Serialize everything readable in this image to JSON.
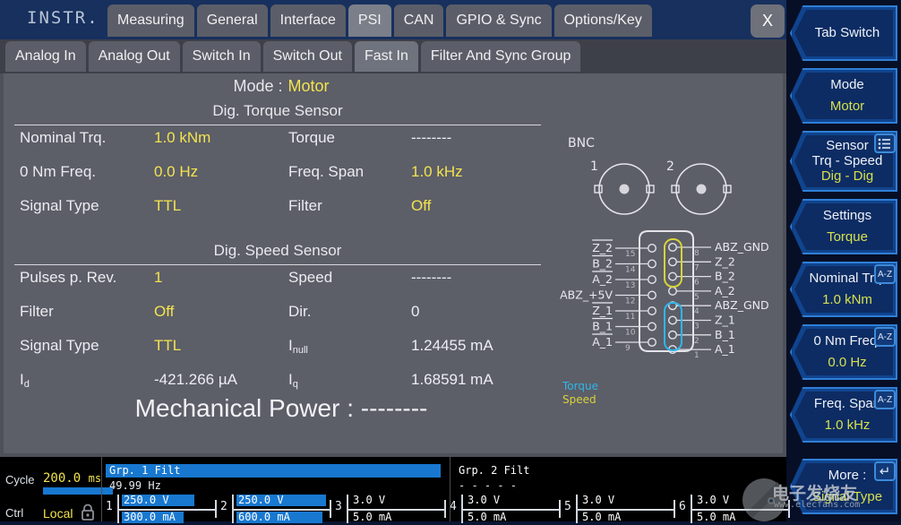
{
  "window": {
    "instrument_label": "INSTR.",
    "close_label": "X"
  },
  "top_tabs": [
    {
      "label": "Measuring",
      "selected": false
    },
    {
      "label": "General",
      "selected": false
    },
    {
      "label": "Interface",
      "selected": false
    },
    {
      "label": "PSI",
      "selected": true
    },
    {
      "label": "CAN",
      "selected": false
    },
    {
      "label": "GPIO & Sync",
      "selected": false
    },
    {
      "label": "Options/Key",
      "selected": false
    }
  ],
  "sub_tabs": [
    {
      "label": "Analog In",
      "selected": false
    },
    {
      "label": "Analog Out",
      "selected": false
    },
    {
      "label": "Switch In",
      "selected": false
    },
    {
      "label": "Switch Out",
      "selected": false
    },
    {
      "label": "Fast In",
      "selected": true
    },
    {
      "label": "Filter And Sync Group",
      "selected": false
    }
  ],
  "main": {
    "mode_label": "Mode :",
    "mode_value": "Motor",
    "torque_section_title": "Dig. Torque Sensor",
    "torque_rows": [
      {
        "label": "Nominal Trq.",
        "value": "1.0 kNm",
        "value_class": "y",
        "label2": "Torque",
        "value2": "--------",
        "value2_class": "w"
      },
      {
        "label": "0 Nm Freq.",
        "value": "0.0 Hz",
        "value_class": "y",
        "label2": "Freq. Span",
        "value2": "1.0 kHz",
        "value2_class": "y"
      },
      {
        "label": "Signal Type",
        "value": "TTL",
        "value_class": "y",
        "label2": "Filter",
        "value2": "Off",
        "value2_class": "y"
      }
    ],
    "speed_section_title": "Dig. Speed Sensor",
    "speed_rows": [
      {
        "label": "Pulses p. Rev.",
        "value": "1",
        "value_class": "y",
        "label2": "Speed",
        "value2": "--------",
        "value2_class": "w"
      },
      {
        "label": "Filter",
        "value": "Off",
        "value_class": "y",
        "label2": "Dir.",
        "value2": "0",
        "value2_class": "w"
      },
      {
        "label": "Signal Type",
        "value": "TTL",
        "value_class": "y",
        "label2": "I_null",
        "label2_base": "I",
        "label2_sub": "null",
        "value2": "1.24455 mA",
        "value2_class": "w"
      },
      {
        "label": "I_d",
        "label_base": "I",
        "label_sub": "d",
        "value": "-421.266 µA",
        "value_class": "w",
        "label2": "I_q",
        "label2_base": "I",
        "label2_sub": "q",
        "value2": "1.68591 mA",
        "value2_class": "w"
      }
    ],
    "mech_power_label": "Mechanical Power :",
    "mech_power_value": "--------"
  },
  "diagram": {
    "bnc_label": "BNC",
    "bnc_1": "1",
    "bnc_2": "2",
    "legend_torque": "Torque",
    "legend_speed": "Speed",
    "colors": {
      "torque": "#2fb6ea",
      "speed": "#d7d23a",
      "outline": "#e8e8ee"
    },
    "left_pins": [
      {
        "pin": "15",
        "label": "Z_2",
        "overline": true
      },
      {
        "pin": "14",
        "label": "B_2",
        "overline": true
      },
      {
        "pin": "13",
        "label": "A_2",
        "overline": true
      },
      {
        "pin": "12",
        "label": "ABZ_+5V",
        "overline": false
      },
      {
        "pin": "11",
        "label": "Z_1",
        "overline": true
      },
      {
        "pin": "10",
        "label": "B_1",
        "overline": true
      },
      {
        "pin": "9",
        "label": "A_1",
        "overline": true
      }
    ],
    "right_pins": [
      {
        "pin": "8",
        "label": "ABZ_GND",
        "group": ""
      },
      {
        "pin": "7",
        "label": "Z_2",
        "group": "speed"
      },
      {
        "pin": "6",
        "label": "B_2",
        "group": "speed"
      },
      {
        "pin": "5",
        "label": "A_2",
        "group": "speed"
      },
      {
        "pin": "4",
        "label": "ABZ_GND",
        "group": ""
      },
      {
        "pin": "3",
        "label": "Z_1",
        "group": "torque"
      },
      {
        "pin": "2",
        "label": "B_1",
        "group": "torque"
      },
      {
        "pin": "1",
        "label": "A_1",
        "group": "torque"
      }
    ]
  },
  "sidebar": [
    {
      "name": "tab-switch",
      "line1": "Tab Switch",
      "line2": "",
      "line3": "",
      "icon": ""
    },
    {
      "name": "mode",
      "line1": "Mode",
      "line2": "",
      "line3": "Motor",
      "icon": ""
    },
    {
      "name": "sensor",
      "line1": "Sensor",
      "line2": "Trq - Speed",
      "line3": "Dig - Dig",
      "icon": "list-icon"
    },
    {
      "name": "settings",
      "line1": "Settings",
      "line2": "",
      "line3": "Torque",
      "icon": ""
    },
    {
      "name": "nominal-trq",
      "line1": "Nominal Trq.",
      "line2": "",
      "line3": "1.0 kNm",
      "icon": "az-icon"
    },
    {
      "name": "zero-nm-freq",
      "line1": "0 Nm Freq.",
      "line2": "",
      "line3": "0.0 Hz",
      "icon": "az-icon"
    },
    {
      "name": "freq-span",
      "line1": "Freq. Span",
      "line2": "",
      "line3": "1.0 kHz",
      "icon": "az-icon"
    },
    {
      "name": "more",
      "line1": "More :",
      "line2": "",
      "line3": "Signal Type",
      "icon": "enter-icon"
    }
  ],
  "status": {
    "cycle_label": "Cycle",
    "cycle_value": "200.0",
    "cycle_unit": "ms",
    "ctrl_label": "Ctrl",
    "ctrl_value": "Local",
    "lock_icon": "lock-icon",
    "groups": [
      {
        "header": "Grp. 1 Filt",
        "header_filled": true,
        "sub": "49.99   Hz"
      },
      {
        "header": "Grp. 2 Filt",
        "header_filled": false,
        "sub": "- - - - -"
      }
    ],
    "channels": [
      {
        "num": "1",
        "volt": "250.0 V",
        "amp": "300.0 mA",
        "volt_fill": 0.78,
        "amp_fill": 0.66
      },
      {
        "num": "2",
        "volt": "250.0 V",
        "amp": "600.0 mA",
        "volt_fill": 0.96,
        "amp_fill": 0.92
      },
      {
        "num": "3",
        "volt": "3.0 V",
        "amp": "5.0 mA",
        "volt_fill": 0,
        "amp_fill": 0
      },
      {
        "num": "4",
        "volt": "3.0 V",
        "amp": "5.0 mA",
        "volt_fill": 0,
        "amp_fill": 0
      },
      {
        "num": "5",
        "volt": "3.0 V",
        "amp": "5.0 mA",
        "volt_fill": 0,
        "amp_fill": 0
      },
      {
        "num": "6",
        "volt": "3.0 V",
        "amp": "5.0 mA",
        "volt_fill": 0,
        "amp_fill": 0
      }
    ]
  },
  "watermark": {
    "text": "电子发烧友",
    "subtext": "www.elecfans.com"
  }
}
